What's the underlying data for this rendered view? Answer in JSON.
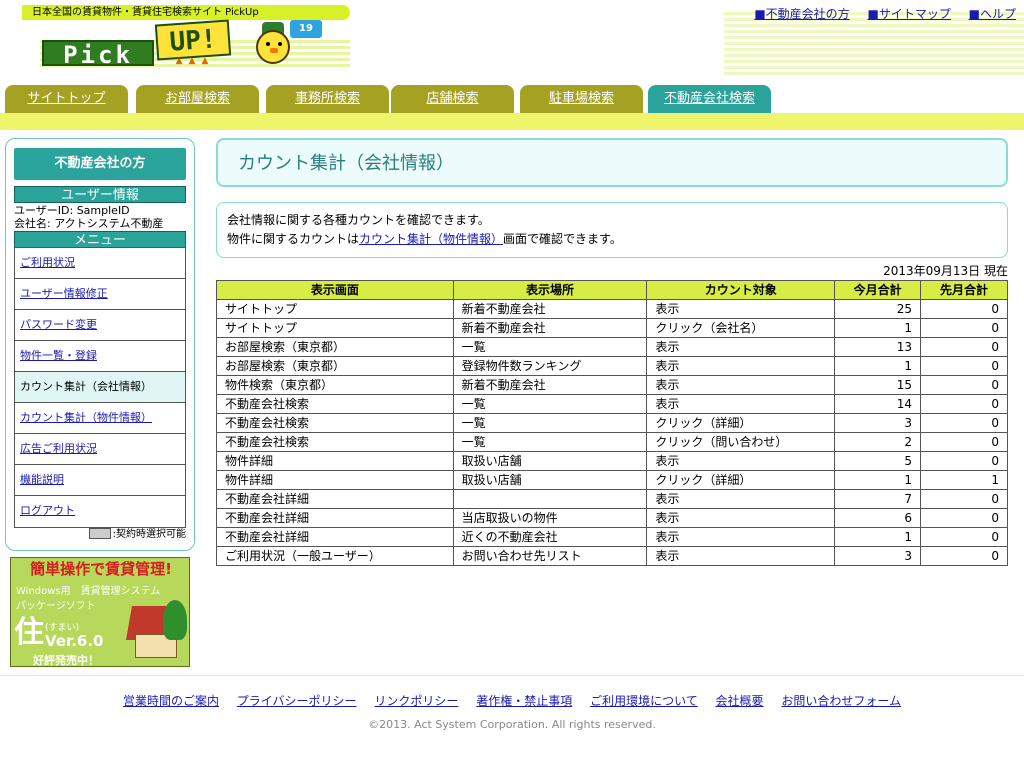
{
  "header": {
    "tagline": "日本全国の賃貸物件・賃貸住宅検索サイト PickUp",
    "logo_pick": "Pick",
    "logo_up": "UP!",
    "mascot_flag": "19",
    "links": [
      "■不動産会社の方",
      "■サイトマップ",
      "■ヘルプ"
    ]
  },
  "tabs": [
    "サイトトップ",
    "お部屋検索",
    "事務所検索",
    "店舗検索",
    "駐車場検索",
    "不動産会社検索"
  ],
  "sidebar": {
    "title": "不動産会社の方",
    "user_heading": "ユーザー情報",
    "user_id": "ユーザーID: SampleID",
    "company": "会社名: アクトシステム不動産",
    "menu_heading": "メニュー",
    "menu": [
      "ご利用状況",
      "ユーザー情報修正",
      "パスワード変更",
      "物件一覧・登録",
      "カウント集計（会社情報）",
      "カウント集計（物件情報）",
      "広告ご利用状況",
      "機能説明",
      "ログアウト"
    ],
    "legend": ":契約時選択可能"
  },
  "ad": {
    "title": "簡単操作で賃貸管理!",
    "line1": "Windows用　賃貸管理システム",
    "line2": "パッケージソフト",
    "char": "住",
    "reading": "(すまい)",
    "version": "Ver.6.0",
    "sale": "好評発売中！"
  },
  "main": {
    "title": "カウント集計（会社情報）",
    "desc_line1": "会社情報に関する各種カウントを確認できます。",
    "desc_line2_pre": "物件に関するカウントは",
    "desc_line2_link": "カウント集計（物件情報）",
    "desc_line2_post": "画面で確認できます。",
    "as_of": "2013年09月13日 現在"
  },
  "table": {
    "headers": [
      "表示画面",
      "表示場所",
      "カウント対象",
      "今月合計",
      "先月合計"
    ],
    "rows": [
      [
        "サイトトップ",
        "新着不動産会社",
        "表示",
        "25",
        "0"
      ],
      [
        "サイトトップ",
        "新着不動産会社",
        "クリック（会社名）",
        "1",
        "0"
      ],
      [
        "お部屋検索（東京都）",
        "一覧",
        "表示",
        "13",
        "0"
      ],
      [
        "お部屋検索（東京都）",
        "登録物件数ランキング",
        "表示",
        "1",
        "0"
      ],
      [
        "物件検索（東京都）",
        "新着不動産会社",
        "表示",
        "15",
        "0"
      ],
      [
        "不動産会社検索",
        "一覧",
        "表示",
        "14",
        "0"
      ],
      [
        "不動産会社検索",
        "一覧",
        "クリック（詳細）",
        "3",
        "0"
      ],
      [
        "不動産会社検索",
        "一覧",
        "クリック（問い合わせ）",
        "2",
        "0"
      ],
      [
        "物件詳細",
        "取扱い店舗",
        "表示",
        "5",
        "0"
      ],
      [
        "物件詳細",
        "取扱い店舗",
        "クリック（詳細）",
        "1",
        "1"
      ],
      [
        "不動産会社詳細",
        "",
        "表示",
        "7",
        "0"
      ],
      [
        "不動産会社詳細",
        "当店取扱いの物件",
        "表示",
        "6",
        "0"
      ],
      [
        "不動産会社詳細",
        "近くの不動産会社",
        "表示",
        "1",
        "0"
      ],
      [
        "ご利用状況（一般ユーザー）",
        "お問い合わせ先リスト",
        "表示",
        "3",
        "0"
      ]
    ]
  },
  "footer": {
    "links": [
      "営業時間のご案内",
      "プライバシーポリシー",
      "リンクポリシー",
      "著作権・禁止事項",
      "ご利用環境について",
      "会社概要",
      "お問い合わせフォーム"
    ],
    "copyright": "©2013. Act System Corporation. All rights reserved."
  },
  "colors": {
    "accent_teal": "#2aa39a",
    "tab_olive": "#a5a223",
    "header_lime": "#d7ec44",
    "link_blue": "#1a1ab0"
  }
}
